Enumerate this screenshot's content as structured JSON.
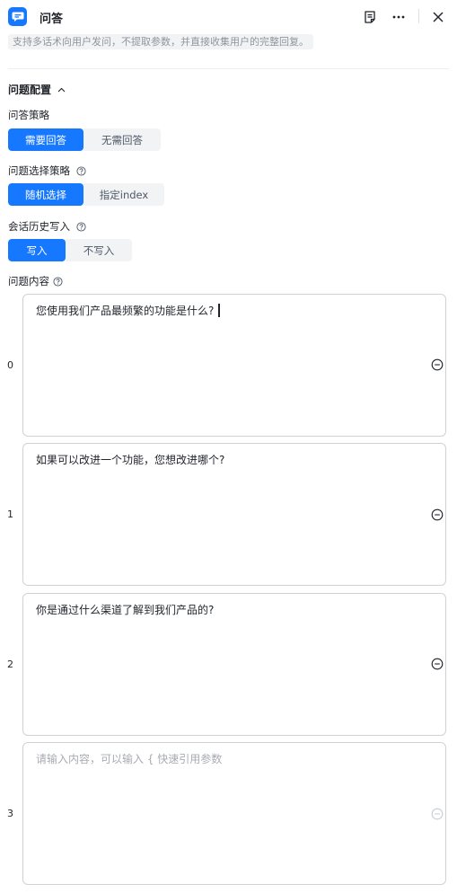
{
  "header": {
    "title": "问答",
    "description": "支持多话术向用户发问，不提取参数，并直接收集用户的完整回复。"
  },
  "section": {
    "title": "问题配置"
  },
  "strategy": {
    "label": "问答策略",
    "options": [
      "需要回答",
      "无需回答"
    ],
    "selected": "需要回答"
  },
  "selection": {
    "label": "问题选择策略",
    "options": [
      "随机选择",
      "指定index"
    ],
    "selected": "随机选择"
  },
  "history": {
    "label": "会话历史写入",
    "options": [
      "写入",
      "不写入"
    ],
    "selected": "写入"
  },
  "questions": {
    "label": "问题内容",
    "items": [
      {
        "index": "0",
        "text": "您使用我们产品最频繁的功能是什么?"
      },
      {
        "index": "1",
        "text": "如果可以改进一个功能，您想改进哪个?"
      },
      {
        "index": "2",
        "text": "你是通过什么渠道了解到我们产品的?"
      },
      {
        "index": "3",
        "text": ""
      }
    ],
    "placeholder": "请输入内容，可以输入 { 快速引用参数"
  },
  "colors": {
    "accent": "#1677ff",
    "border": "#d0d3d6",
    "muted_bg": "#f2f3f5"
  }
}
